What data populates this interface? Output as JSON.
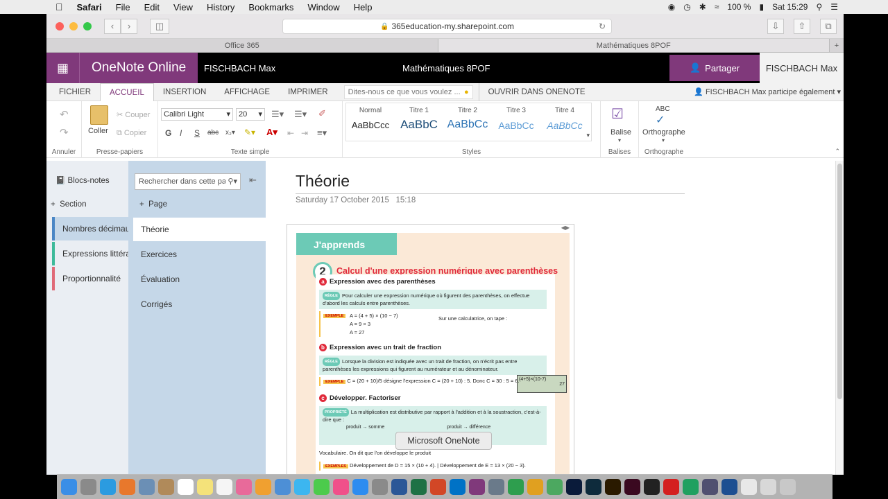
{
  "menubar": {
    "apple": "",
    "app": "Safari",
    "items": [
      "File",
      "Edit",
      "View",
      "History",
      "Bookmarks",
      "Window",
      "Help"
    ],
    "battery": "100 %",
    "clock": "Sat 15:29"
  },
  "browser": {
    "url": "365education-my.sharepoint.com",
    "tabs": [
      {
        "label": "Office 365",
        "active": false
      },
      {
        "label": "Mathématiques 8POF",
        "active": true
      }
    ]
  },
  "header": {
    "app_name": "OneNote Online",
    "user": "FISCHBACH Max",
    "notebook_title": "Mathématiques 8POF",
    "share_label": "Partager",
    "user_right": "FISCHBACH Max"
  },
  "ribbon_tabs": {
    "file": "FICHIER",
    "home": "ACCUEIL",
    "insert": "INSERTION",
    "view": "AFFICHAGE",
    "print": "IMPRIMER",
    "tell_me": "Dites-nous ce que vous voulez ...",
    "open_in": "OUVRIR DANS ONENOTE",
    "participants": "FISCHBACH Max participe également"
  },
  "ribbon": {
    "undo_group": "Annuler",
    "clipboard_group": "Presse-papiers",
    "paste": "Coller",
    "cut": "Couper",
    "copy": "Copier",
    "font_name": "Calibri Light",
    "font_size": "20",
    "basic_text_group": "Texte simple",
    "styles_group": "Styles",
    "styles": [
      {
        "name": "Normal",
        "sample": "AaBbCcc"
      },
      {
        "name": "Titre 1",
        "sample": "AaBbC"
      },
      {
        "name": "Titre 2",
        "sample": "AaBbCc"
      },
      {
        "name": "Titre 3",
        "sample": "AaBbCc"
      },
      {
        "name": "Titre 4",
        "sample": "AaBbCc"
      }
    ],
    "tag": "Balise",
    "tags_group": "Balises",
    "spelling": "Orthographe",
    "spelling_group": "Orthographe",
    "spelling_icon_text": "ABC"
  },
  "navigation": {
    "notebooks": "Blocs-notes",
    "add_section": "Section",
    "sections": [
      {
        "label": "Nombres décimaux",
        "color": "#4a86c5",
        "active": true
      },
      {
        "label": "Expressions littérales",
        "color": "#3dba9a",
        "active": false
      },
      {
        "label": "Proportionnalité",
        "color": "#e06a78",
        "active": false
      }
    ],
    "search_placeholder": "Rechercher dans cette page",
    "add_page": "Page",
    "pages": [
      {
        "label": "Théorie",
        "active": true
      },
      {
        "label": "Exercices",
        "active": false
      },
      {
        "label": "Évaluation",
        "active": false
      },
      {
        "label": "Corrigés",
        "active": false
      }
    ]
  },
  "page": {
    "title": "Théorie",
    "date": "Saturday 17 October 2015",
    "time": "15:18"
  },
  "document": {
    "banner": "J'apprends",
    "number": "2",
    "title": "Calcul d'une expression numérique avec parenthèses",
    "sub_a": "Expression avec des parenthèses",
    "rule_tag": "RÈGLE",
    "rule_a": "Pour calculer une expression numérique où figurent des parenthèses, on effectue d'abord les calculs entre parenthèses.",
    "example_tag": "EXEMPLE",
    "ex_line1": "A = (4 + 5) × (10 − 7)",
    "ex_line2": "A = 9 × 3",
    "ex_line3": "A = 27",
    "calc_intro": "Sur une calculatrice, on tape :",
    "calc_screen": "(4+5)×(10-7)",
    "calc_result": "27",
    "sub_b": "Expression avec un trait de fraction",
    "rule_b": "Lorsque la division est indiquée avec un trait de fraction, on n'écrit pas entre parenthèses les expressions qui figurent au numérateur et au dénominateur.",
    "ex_b": "C = (20 + 10)/5 désigne l'expression C = (20 + 10) : 5. Donc C = 30 : 5 = 6.",
    "sub_c": "Développer. Factoriser",
    "prop_tag": "PROPRIÉTÉ",
    "prop_c": "La multiplication est distributive par rapport à l'addition et à la soustraction, c'est-à-dire que :",
    "formula_sum": "produit → somme",
    "formula_diff": "produit → différence",
    "vocab": "Vocabulaire. On dit que l'on développe le produit",
    "examples_tag": "EXEMPLES",
    "ex_c": "Développement de D = 15 × (10 + 4).   |   Développement de E = 13 × (20 − 3)."
  },
  "tooltip": "Microsoft OneNote",
  "dock": {
    "apps": [
      "Finder",
      "Launchpad",
      "Safari",
      "Firefox",
      "Preview",
      "Contacts",
      "Calendar",
      "Notes",
      "Reminders",
      "Photos",
      "Pages",
      "Keynote",
      "Messages",
      "FaceTime",
      "iTunes",
      "App Store",
      "Preferences",
      "Word",
      "Excel",
      "PowerPoint",
      "Outlook",
      "OneNote",
      "Network",
      "Numbers",
      "Keynote2",
      "Geogebra",
      "Photoshop",
      "Lightroom",
      "Illustrator",
      "InDesign",
      "Unity",
      "Recorder",
      "Camtasia",
      "Biblio",
      "Quicktime",
      "Folder",
      "Downloads",
      "Trash"
    ]
  }
}
